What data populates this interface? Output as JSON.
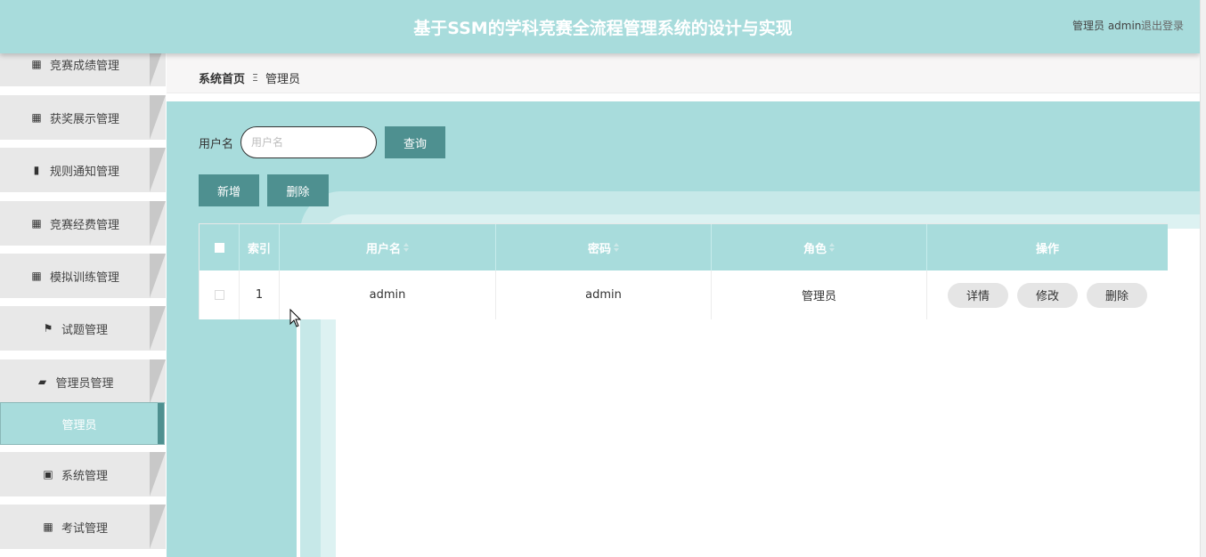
{
  "header": {
    "title": "基于SSM的学科竞赛全流程管理系统的设计与实现",
    "user_label": "管理员 admin",
    "logout_label": "退出登录"
  },
  "breadcrumb": {
    "home": "系统首页",
    "separator": "Ξ",
    "current": "管理员"
  },
  "sidebar": {
    "items": [
      {
        "icon": "grid-icon",
        "label": "竞赛成绩管理"
      },
      {
        "icon": "grid-icon",
        "label": "获奖展示管理"
      },
      {
        "icon": "bar-chart-icon",
        "label": "规则通知管理"
      },
      {
        "icon": "grid-icon",
        "label": "竞赛经费管理"
      },
      {
        "icon": "grid-icon",
        "label": "模拟训练管理"
      },
      {
        "icon": "flag-icon",
        "label": "试题管理"
      },
      {
        "icon": "ticket-icon",
        "label": "管理员管理"
      },
      {
        "icon": "clipboard-icon",
        "label": "系统管理"
      },
      {
        "icon": "grid-icon",
        "label": "考试管理"
      }
    ],
    "active_sub_item": "管理员"
  },
  "search": {
    "label": "用户名",
    "placeholder": "用户名",
    "value": "",
    "query_button": "查询"
  },
  "actions": {
    "add_button": "新增",
    "delete_button": "删除"
  },
  "table": {
    "columns": [
      "索引",
      "用户名",
      "密码",
      "角色",
      "操作"
    ],
    "rows": [
      {
        "index": "1",
        "username": "admin",
        "password": "admin",
        "role": "管理员"
      }
    ],
    "row_actions": {
      "detail": "详情",
      "edit": "修改",
      "delete": "删除"
    }
  },
  "colors": {
    "primary": "#a8dcdc",
    "button": "#4e9090",
    "menu_bg": "#e8e8e8"
  }
}
